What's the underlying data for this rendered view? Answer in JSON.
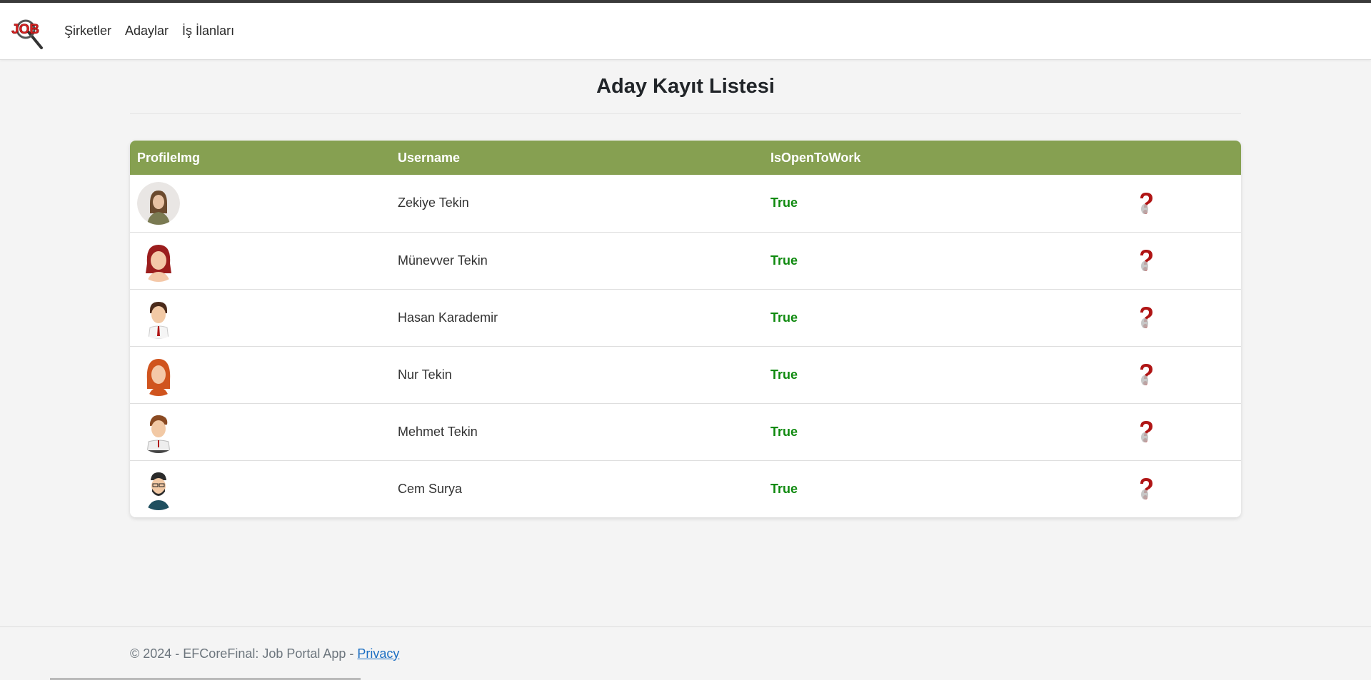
{
  "nav": {
    "logo_text": "JOB",
    "links": [
      "Şirketler",
      "Adaylar",
      "İş İlanları"
    ]
  },
  "page": {
    "title": "Aday Kayıt Listesi"
  },
  "table": {
    "headers": [
      "ProfileImg",
      "Username",
      "IsOpenToWork",
      ""
    ],
    "rows": [
      {
        "username": "Zekiye Tekin",
        "open": "True"
      },
      {
        "username": "Münevver Tekin",
        "open": "True"
      },
      {
        "username": "Hasan Karademir",
        "open": "True"
      },
      {
        "username": "Nur Tekin",
        "open": "True"
      },
      {
        "username": "Mehmet Tekin",
        "open": "True"
      },
      {
        "username": "Cem Surya",
        "open": "True"
      }
    ]
  },
  "footer": {
    "copyright": "© 2024 - EFCoreFinal: Job Portal App - ",
    "privacy_link": "Privacy"
  },
  "colors": {
    "header_green": "#86a051",
    "status_green": "#0f8a0f",
    "link_blue": "#1b6ec2"
  },
  "icons": {
    "logo": "job-search-logo",
    "row_action": "question-mark-icon"
  }
}
